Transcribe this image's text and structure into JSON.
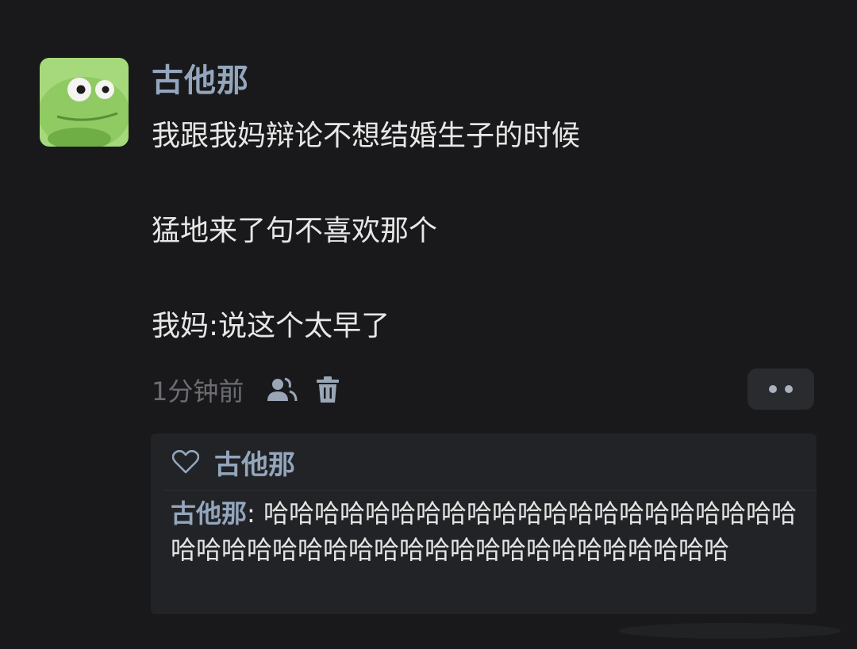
{
  "post": {
    "author": "古他那",
    "lines": [
      "我跟我妈辩论不想结婚生子的时候",
      "猛地来了句不喜欢那个",
      "我妈:说这个太早了"
    ],
    "time": "1分钟前"
  },
  "icons": {
    "visibility": "people-icon",
    "delete": "trash-icon",
    "more": "more-dots-icon",
    "like": "heart-icon"
  },
  "comments": {
    "liked_by": "古他那",
    "reply": {
      "author": "古他那",
      "separator": ": ",
      "text": "哈哈哈哈哈哈哈哈哈哈哈哈哈哈哈哈哈哈哈哈哈哈哈哈哈哈哈哈哈哈哈哈哈哈哈哈哈哈哈哈哈哈哈"
    }
  },
  "colors": {
    "background": "#19191b",
    "name": "#93a6bd",
    "text": "#e7e7e7",
    "meta": "#6b6d72",
    "comment_bg": "#222326",
    "avatar_green": "#9bd36a"
  }
}
